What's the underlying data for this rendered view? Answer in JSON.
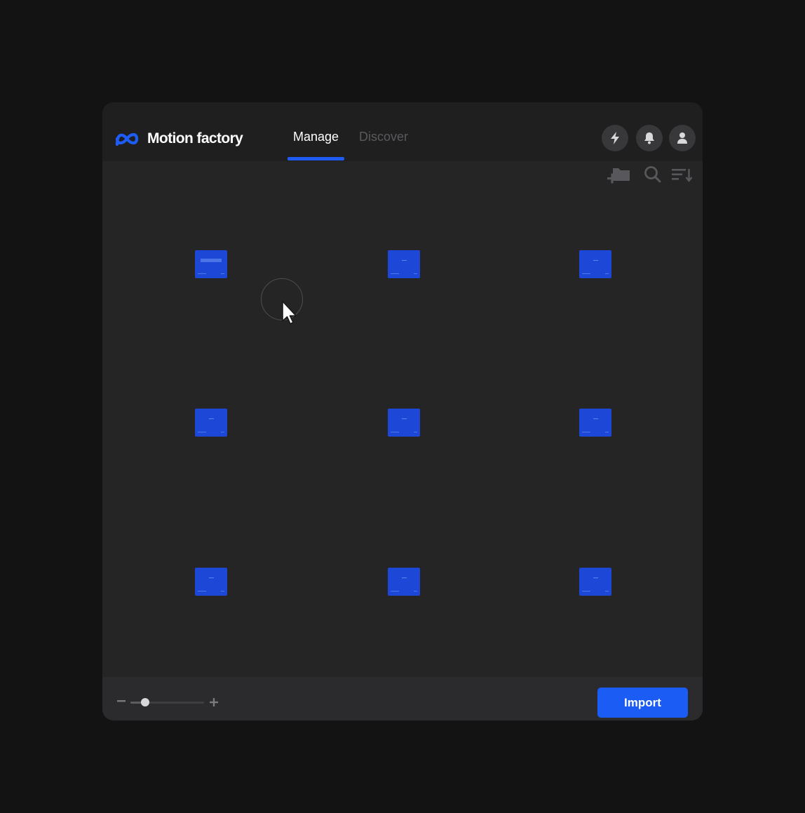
{
  "app": {
    "name": "Motion factory",
    "logo_icon": "meta-infinity-logo-icon"
  },
  "tabs": [
    {
      "label": "Manage",
      "active": true
    },
    {
      "label": "Discover",
      "active": false
    }
  ],
  "header_actions": [
    {
      "icon": "bolt-icon"
    },
    {
      "icon": "bell-icon"
    },
    {
      "icon": "user-icon"
    }
  ],
  "toolbar": {
    "icons": [
      "add-folder-icon",
      "search-icon",
      "sort-icon"
    ]
  },
  "grid": {
    "items": [
      {
        "thumbnail": "banner"
      },
      {
        "thumbnail": "plain"
      },
      {
        "thumbnail": "plain"
      },
      {
        "thumbnail": "plain"
      },
      {
        "thumbnail": "plain"
      },
      {
        "thumbnail": "plain"
      },
      {
        "thumbnail": "plain"
      },
      {
        "thumbnail": "plain"
      },
      {
        "thumbnail": "plain"
      }
    ]
  },
  "footer": {
    "zoom_level": 0.2,
    "import_label": "Import"
  },
  "colors": {
    "accent": "#1b5cf5",
    "background": "#131314",
    "panel": "#252526",
    "thumbnail": "#1d47d6"
  }
}
